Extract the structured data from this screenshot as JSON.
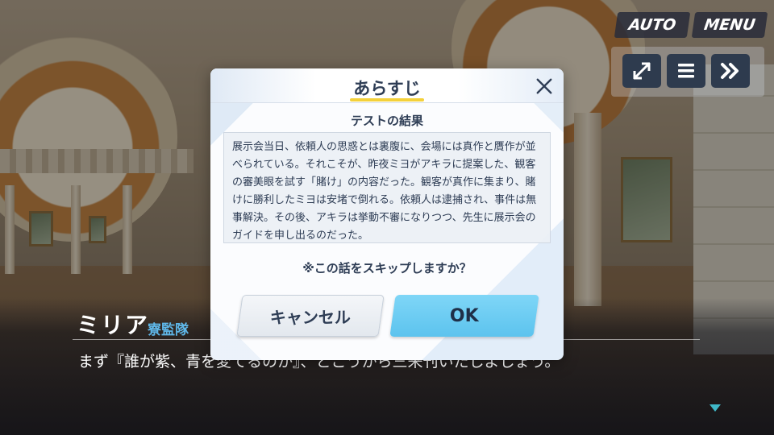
{
  "hud": {
    "auto_label": "AUTO",
    "menu_label": "MENU",
    "icons": [
      "fullscreen-icon",
      "log-icon",
      "fast-forward-icon"
    ]
  },
  "dialogue": {
    "speaker_name": "ミリア",
    "speaker_affiliation": "寮監隊",
    "text": "まず『誰が紫、青を変てるのか』、とこうから三来刊いたしよしょう。"
  },
  "modal": {
    "title": "あらすじ",
    "subtitle": "テストの結果",
    "summary": "展示会当日、依頼人の思惑とは裏腹に、会場には真作と贋作が並べられている。それこそが、昨夜ミヨがアキラに提案した、観客の審美眼を試す「賭け」の内容だった。観客が真作に集まり、賭けに勝利したミヨは安堵で倒れる。依頼人は逮捕され、事件は無事解決。その後、アキラは挙動不審になりつつ、先生に展示会のガイドを申し出るのだった。",
    "question": "※この話をスキップしますか？",
    "cancel_label": "キャンセル",
    "ok_label": "OK"
  },
  "colors": {
    "ok_button": "#5cc3ee",
    "title_underline": "#f4d13a",
    "affiliation_text": "#5fb7e8",
    "next_indicator": "#3fb8c8"
  }
}
